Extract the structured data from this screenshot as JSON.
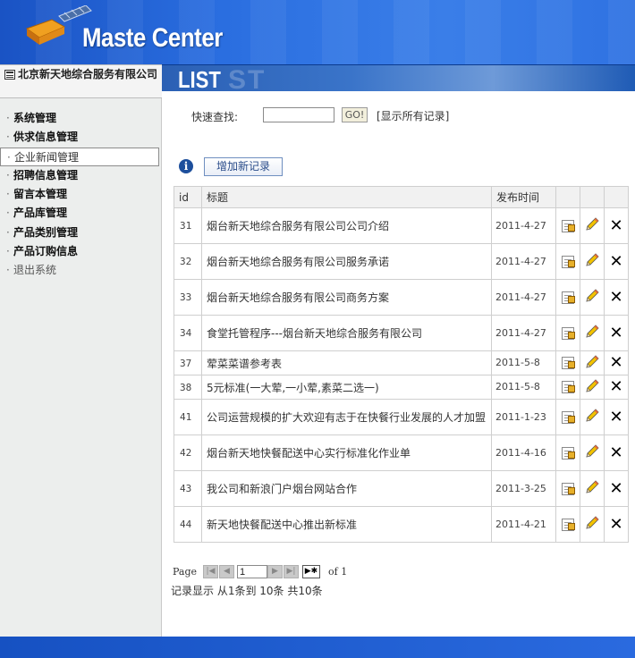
{
  "header": {
    "title": "Maste Center"
  },
  "sidebar": {
    "company": "北京新天地综合服务有限公司",
    "items": [
      {
        "label": "系统管理"
      },
      {
        "label": "供求信息管理"
      },
      {
        "label": "企业新闻管理"
      },
      {
        "label": "招聘信息管理"
      },
      {
        "label": "留言本管理"
      },
      {
        "label": "产品库管理"
      },
      {
        "label": "产品类别管理"
      },
      {
        "label": "产品订购信息"
      },
      {
        "label": "退出系统"
      }
    ],
    "active_index": 2
  },
  "banner": {
    "title": "LIST",
    "ghost": "ST"
  },
  "search": {
    "label": "快速查找:",
    "value": "",
    "go_label": "GO!",
    "show_all": "[显示所有记录]"
  },
  "toolbar": {
    "add_label": "增加新记录"
  },
  "table": {
    "headers": [
      "id",
      "标题",
      "发布时间",
      "",
      "",
      ""
    ],
    "rows": [
      {
        "id": "31",
        "title": "烟台新天地综合服务有限公司公司介绍",
        "date": "2011-4-27"
      },
      {
        "id": "32",
        "title": "烟台新天地综合服务有限公司服务承诺",
        "date": "2011-4-27"
      },
      {
        "id": "33",
        "title": "烟台新天地综合服务有限公司商务方案",
        "date": "2011-4-27"
      },
      {
        "id": "34",
        "title": "食堂托管程序---烟台新天地综合服务有限公司",
        "date": "2011-4-27"
      },
      {
        "id": "37",
        "title": "荤菜菜谱参考表",
        "date": "2011-5-8"
      },
      {
        "id": "38",
        "title": "5元标准(一大荤,一小荤,素菜二选一)",
        "date": "2011-5-8"
      },
      {
        "id": "41",
        "title": "公司运营规模的扩大欢迎有志于在快餐行业发展的人才加盟",
        "date": "2011-1-23"
      },
      {
        "id": "42",
        "title": "烟台新天地快餐配送中心实行标准化作业单",
        "date": "2011-4-16"
      },
      {
        "id": "43",
        "title": "我公司和新浪门户烟台网站合作",
        "date": "2011-3-25"
      },
      {
        "id": "44",
        "title": "新天地快餐配送中心推出新标准",
        "date": "2011-4-21"
      }
    ]
  },
  "pager": {
    "label": "Page",
    "current": "1",
    "of_label": "of 1",
    "summary": "记录显示 从1条到 10条 共10条"
  },
  "colors": {
    "header_blue": "#1a53c4",
    "sidebar_bg": "#eceeed",
    "footer_blue": "#1651c2"
  }
}
